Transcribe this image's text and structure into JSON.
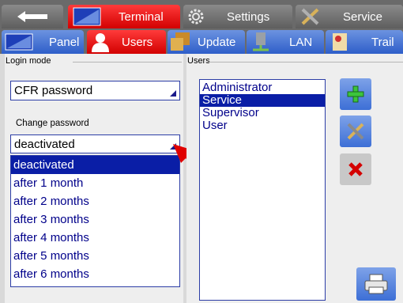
{
  "tabs_top": [
    {
      "label": "",
      "icon": "back-arrow-icon"
    },
    {
      "label": "Terminal",
      "icon": "terminal-icon"
    },
    {
      "label": "Settings",
      "icon": "gear-icon"
    },
    {
      "label": "Service",
      "icon": "tools-icon"
    }
  ],
  "tabs_sub": [
    {
      "label": "Panel",
      "icon": "panel-icon"
    },
    {
      "label": "Users",
      "icon": "user-icon"
    },
    {
      "label": "Update",
      "icon": "update-icon"
    },
    {
      "label": "LAN",
      "icon": "lan-icon"
    },
    {
      "label": "Trail",
      "icon": "trail-icon"
    }
  ],
  "login": {
    "group_label": "Login mode",
    "mode_value": "CFR password",
    "change_password_label": "Change password",
    "change_password_value": "deactivated",
    "options": [
      "deactivated",
      "after 1 month",
      "after 2 months",
      "after 3 months",
      "after 4 months",
      "after 5 months",
      "after 6 months"
    ],
    "selected_index": 0
  },
  "users": {
    "group_label": "Users",
    "items": [
      "Administrator",
      "Service",
      "Supervisor",
      "User"
    ],
    "selected_index": 1
  },
  "buttons": {
    "add": "plus-icon",
    "edit": "tools-icon",
    "delete": "x-icon",
    "print": "printer-icon"
  },
  "colors": {
    "accent_red": "#e00000",
    "accent_blue": "#0a1ea6",
    "arrow": "#e00000"
  }
}
